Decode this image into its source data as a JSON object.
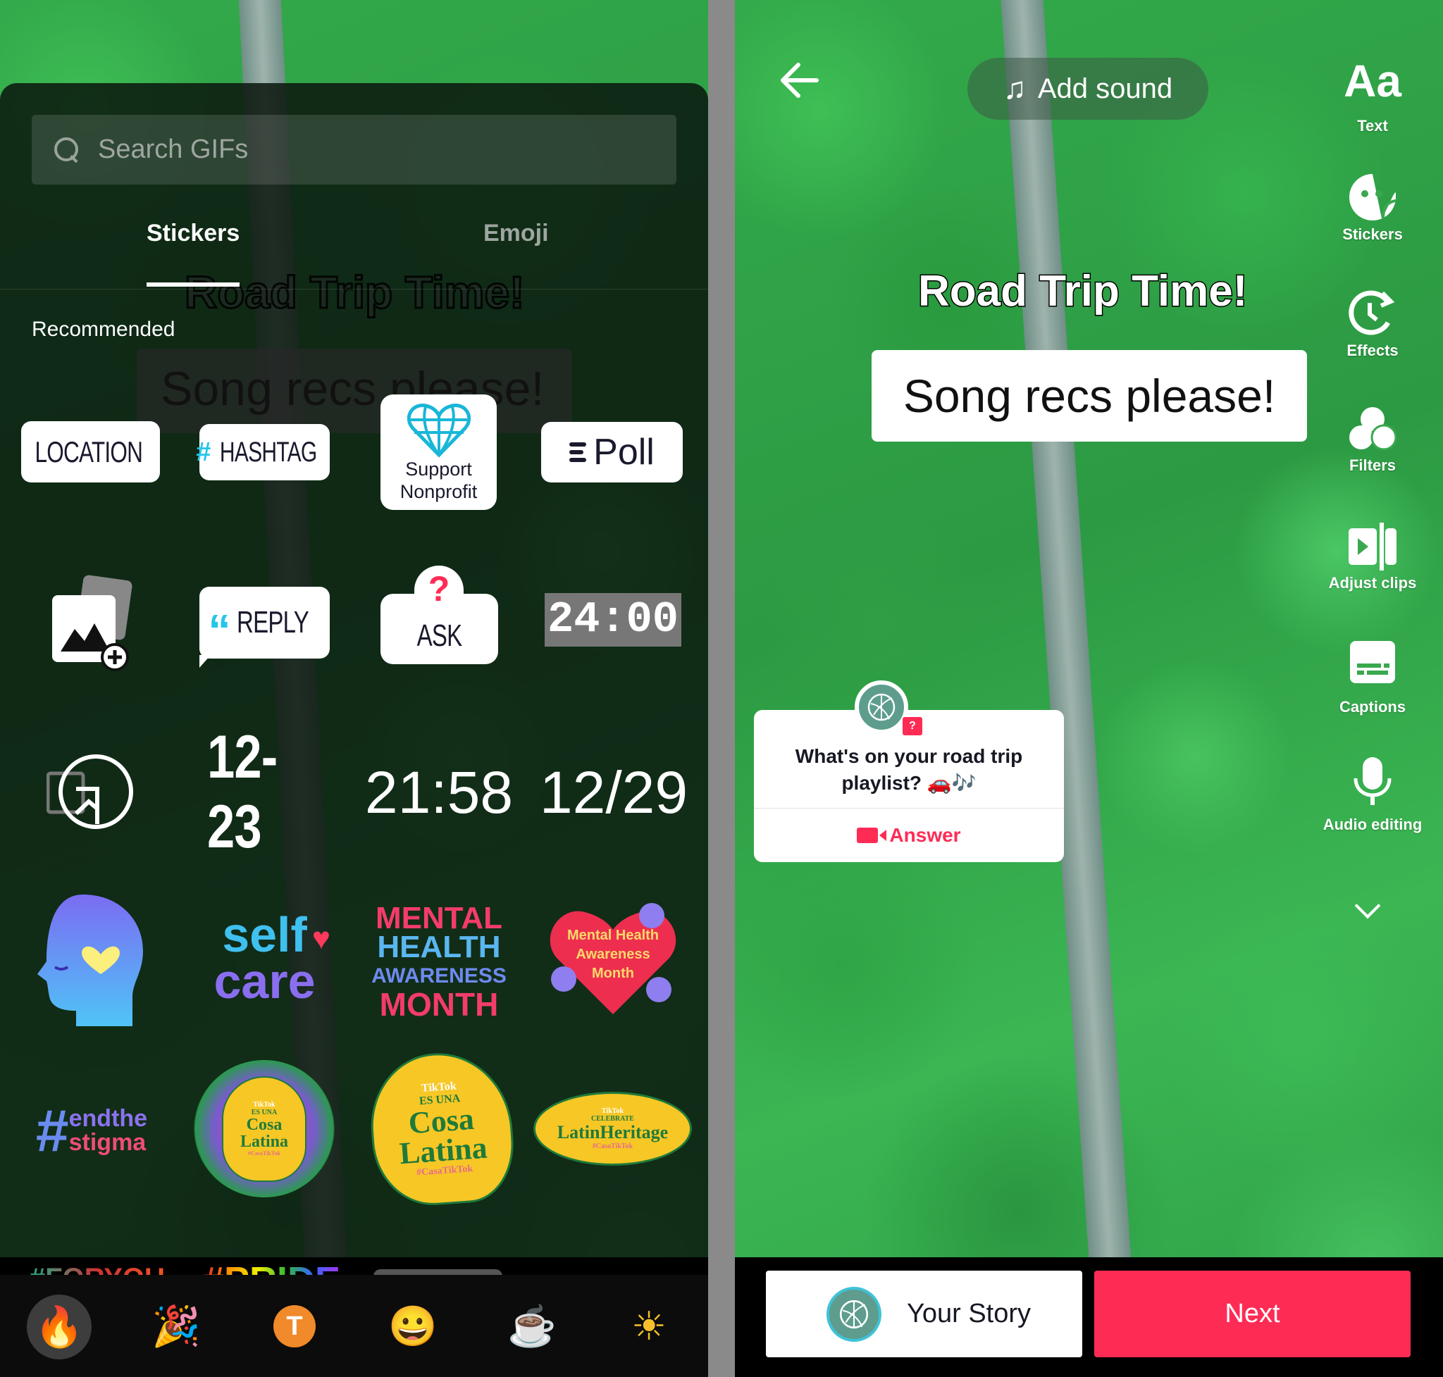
{
  "left_panel": {
    "search": {
      "placeholder": "Search GIFs",
      "icon": "search-icon"
    },
    "tabs": [
      {
        "label": "Stickers",
        "active": true
      },
      {
        "label": "Emoji",
        "active": false
      }
    ],
    "section_label": "Recommended",
    "background_overlay_text": {
      "title": "Road Trip Time!",
      "caption": "Song recs please!"
    },
    "stickers": {
      "location": "LOCATION",
      "hashtag": "HASHTAG",
      "nonprofit_line1": "Support",
      "nonprofit_line2": "Nonprofit",
      "poll": "Poll",
      "reply": "REPLY",
      "ask": "ASK",
      "flip_clock": "24:00",
      "date_dash": "12-23",
      "time": "21:58",
      "date_slash": "12/29",
      "self_care_line1": "self",
      "self_care_line2": "care",
      "mental_health": [
        "MENTAL",
        "HEALTH",
        "AWARENESS",
        "MONTH"
      ],
      "mental_health_heart": [
        "Mental Health",
        "Awareness",
        "Month"
      ],
      "end_stigma_line1": "endthe",
      "end_stigma_line2": "stigma",
      "cosa_latina_small": {
        "brand": "TikTok",
        "pre": "ES UNA",
        "line1": "Cosa",
        "line2": "Latina",
        "tag": "#CasaTikTok"
      },
      "cosa_latina_large": {
        "brand": "TikTok",
        "pre": "ES UNA",
        "line1": "Cosa",
        "line2": "Latina",
        "tag": "#CasaTikTok"
      },
      "latin_heritage": {
        "brand": "TikTok",
        "pre": "CELEBRATE",
        "main": "LatinHeritage",
        "tag": "#CasaTikTok"
      }
    },
    "peek_row": [
      "#FORYOU",
      "#PRIDE"
    ],
    "emoji_tray": [
      {
        "name": "fire",
        "glyph": "🔥",
        "selected": true
      },
      {
        "name": "party-popper",
        "glyph": "🎉",
        "selected": false
      },
      {
        "name": "text-sticker",
        "glyph": "T",
        "selected": false
      },
      {
        "name": "grinning-face",
        "glyph": "😀",
        "selected": false
      },
      {
        "name": "hot-beverage",
        "glyph": "☕",
        "selected": false
      },
      {
        "name": "sun",
        "glyph": "☀",
        "selected": false
      }
    ]
  },
  "right_panel": {
    "add_sound": "Add sound",
    "title_text": "Road Trip Time!",
    "caption_text": "Song recs please!",
    "tools": [
      {
        "label": "Text",
        "icon": "text-icon"
      },
      {
        "label": "Stickers",
        "icon": "sticker-icon"
      },
      {
        "label": "Effects",
        "icon": "effects-icon"
      },
      {
        "label": "Filters",
        "icon": "filters-icon"
      },
      {
        "label": "Adjust clips",
        "icon": "adjust-clips-icon"
      },
      {
        "label": "Captions",
        "icon": "captions-icon"
      },
      {
        "label": "Audio editing",
        "icon": "audio-editing-icon"
      }
    ],
    "text_tool_glyph": "Aa",
    "question_card": {
      "question": "What's on your road trip playlist? 🚗🎶",
      "badge": "?",
      "answer_label": "Answer"
    },
    "your_story": "Your Story",
    "next": "Next"
  },
  "colors": {
    "accent": "#fe2c55",
    "teal": "#25c6e8",
    "avatar": "#5e9d8e"
  }
}
